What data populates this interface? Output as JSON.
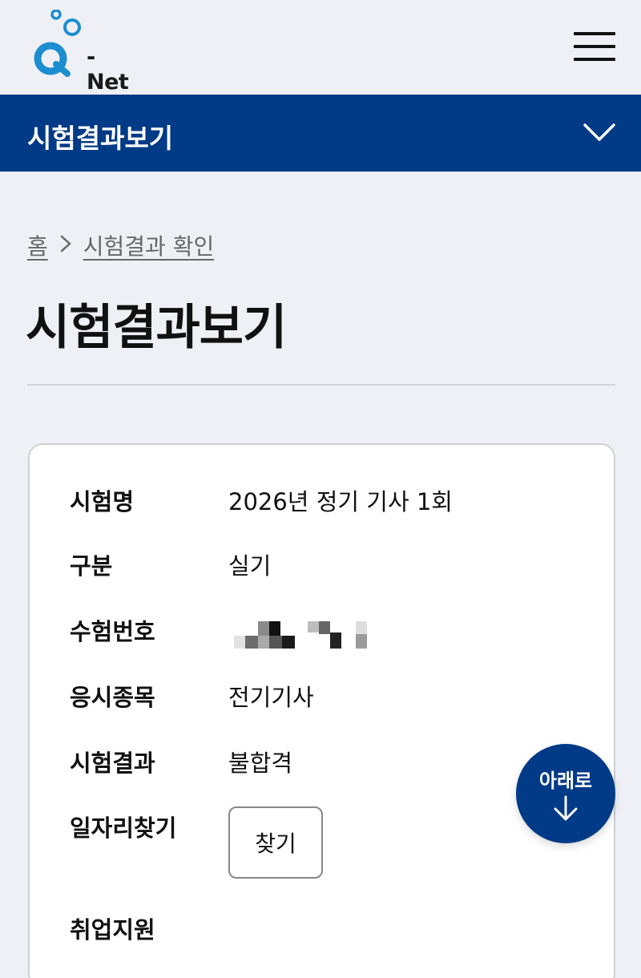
{
  "header": {
    "logo_text": "- Net",
    "brand_color": "#1c8ed0",
    "menu_icon": "hamburger-menu-icon"
  },
  "nav": {
    "title": "시험결과보기",
    "background": "#013a86",
    "toggle_icon": "chevron-down-icon"
  },
  "breadcrumb": {
    "home": "홈",
    "separator_icon": "chevron-right-icon",
    "current": "시험결과 확인"
  },
  "page": {
    "title": "시험결과보기"
  },
  "result": {
    "rows": [
      {
        "label": "시험명",
        "value": "2026년 정기 기사 1회"
      },
      {
        "label": "구분",
        "value": "실기"
      },
      {
        "label": "수험번호",
        "value": ""
      },
      {
        "label": "응시종목",
        "value": "전기기사"
      },
      {
        "label": "시험결과",
        "value": "불합격"
      },
      {
        "label": "일자리찾기",
        "value": ""
      },
      {
        "label": "취업지원",
        "value": ""
      }
    ],
    "find_button": "찾기"
  },
  "fab": {
    "label": "아래로",
    "icon": "arrow-down-icon"
  }
}
